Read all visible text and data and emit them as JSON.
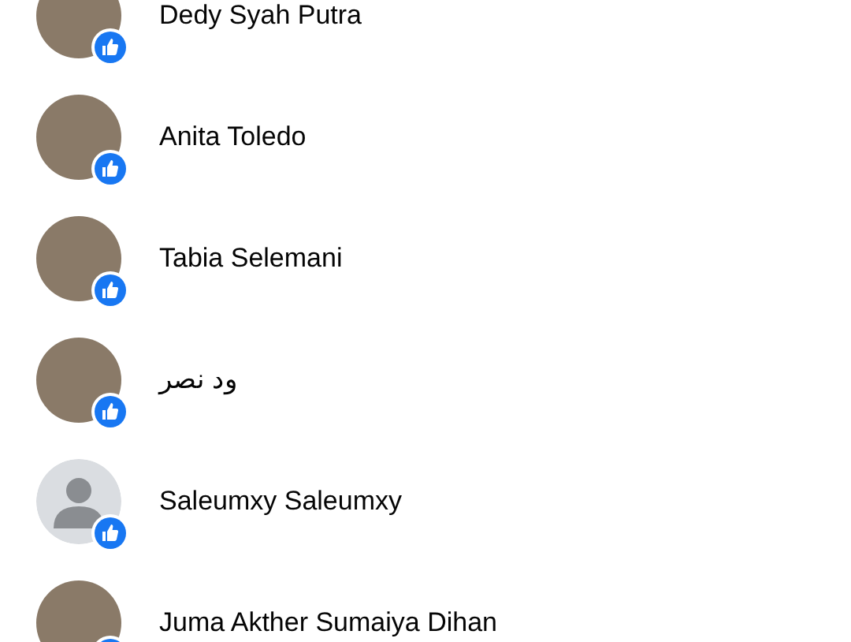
{
  "people": [
    {
      "name": "Dedy Syah Putra",
      "kind": "photo",
      "liked": true
    },
    {
      "name": "Anita Toledo",
      "kind": "photo",
      "liked": true
    },
    {
      "name": "Tabia Selemani",
      "kind": "photo",
      "liked": true
    },
    {
      "name": "ود نصر",
      "kind": "photo",
      "liked": true
    },
    {
      "name": "Saleumxy Saleumxy",
      "kind": "default",
      "liked": true
    },
    {
      "name": "Juma Akther Sumaiya Dihan",
      "kind": "photo",
      "liked": true
    }
  ]
}
